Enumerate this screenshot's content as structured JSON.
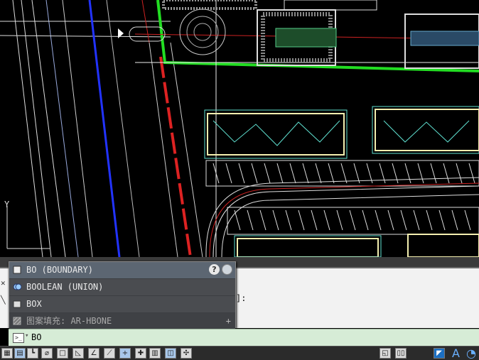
{
  "autocomplete": {
    "items": [
      {
        "label": "BO (BOUNDARY)",
        "icon": "boundary-icon",
        "selected": true
      },
      {
        "label": "BOOLEAN (UNION)",
        "icon": "union-icon",
        "selected": false
      },
      {
        "label": "BOX",
        "icon": "box-icon",
        "selected": false
      },
      {
        "label": "图案填充: AR-HBONE",
        "icon": "hatch-icon",
        "selected": false
      }
    ],
    "help_label": "?"
  },
  "command_line": {
    "input_value": "BO",
    "history_text": "]:"
  },
  "colors": {
    "canvas_bg": "#000000",
    "boundary_green": "#22dd22",
    "road_red": "#dd2222",
    "line_blue": "#2233ff",
    "building_outline": "#f4efb0",
    "building_cyan": "#5fe0d0",
    "command_bg": "#d6ecd6"
  },
  "statusbar": {
    "left_icons": [
      "model-icon",
      "grid-icon",
      "snap-icon",
      "ortho-icon",
      "polar-icon",
      "osnap-icon",
      "3dosnap-icon",
      "otrack-icon",
      "ducs-icon",
      "dyn-icon",
      "lwt-icon",
      "tpy-icon",
      "qp-icon",
      "sc-icon",
      "am-icon"
    ],
    "right_icons": [
      "layout-icon",
      "viewport-icon",
      "bim-icon",
      "annotation-icon",
      "scale-icon"
    ],
    "annotation_label": "A"
  },
  "canvas": {
    "ucs_label": "Y"
  }
}
